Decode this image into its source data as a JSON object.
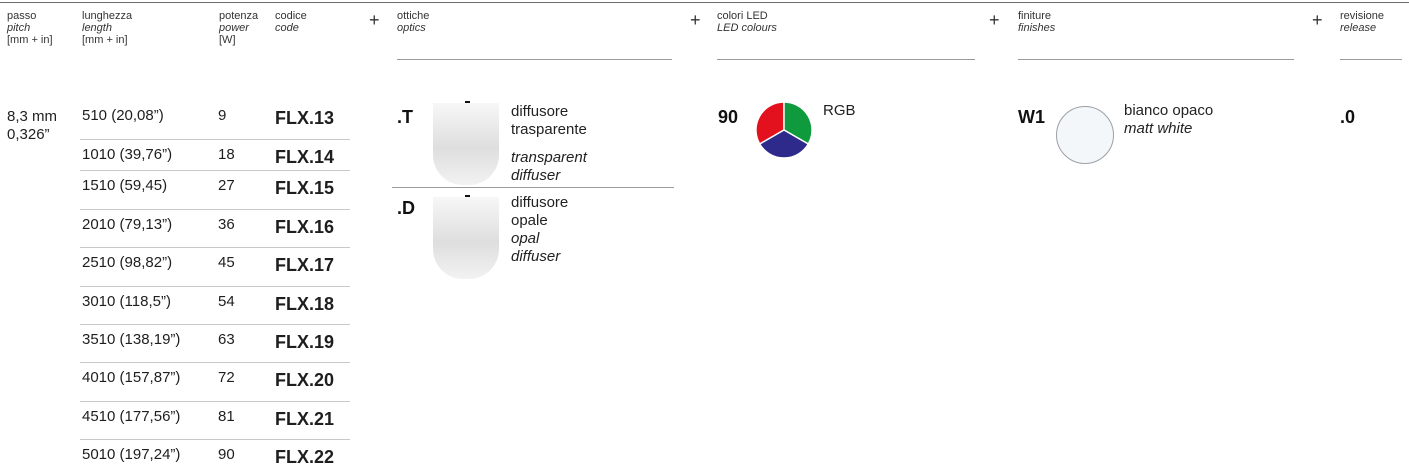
{
  "headers": {
    "pitch": {
      "it": "passo",
      "en": "pitch",
      "unit": "[mm + in]"
    },
    "length": {
      "it": "lunghezza",
      "en": "length",
      "unit": "[mm + in]"
    },
    "power": {
      "it": "potenza",
      "en": "power",
      "unit": "[W]"
    },
    "code": {
      "it": "codice",
      "en": "code"
    },
    "optics": {
      "it": "ottiche",
      "en": "optics"
    },
    "led": {
      "it": "colori LED",
      "en": "LED colours"
    },
    "finishes": {
      "it": "finiture",
      "en": "finishes"
    },
    "release": {
      "it": "revisione",
      "en": "release"
    },
    "plus": "+"
  },
  "pitch": {
    "mm": "8,3 mm",
    "in": "0,326”"
  },
  "rows": [
    {
      "length": "510 (20,08”)",
      "power": "9",
      "code": "FLX.13"
    },
    {
      "length": "1010 (39,76”)",
      "power": "18",
      "code": "FLX.14"
    },
    {
      "length": "1510 (59,45)",
      "power": "27",
      "code": "FLX.15"
    },
    {
      "length": "2010 (79,13”)",
      "power": "36",
      "code": "FLX.16"
    },
    {
      "length": "2510 (98,82”)",
      "power": "45",
      "code": "FLX.17"
    },
    {
      "length": "3010 (118,5”)",
      "power": "54",
      "code": "FLX.18"
    },
    {
      "length": "3510 (138,19”)",
      "power": "63",
      "code": "FLX.19"
    },
    {
      "length": "4010 (157,87”)",
      "power": "72",
      "code": "FLX.20"
    },
    {
      "length": "4510 (177,56”)",
      "power": "81",
      "code": "FLX.21"
    },
    {
      "length": "5010 (197,24”)",
      "power": "90",
      "code": "FLX.22"
    }
  ],
  "optics": [
    {
      "code": ".T",
      "it1": "diffusore",
      "it2": "trasparente",
      "en1": "transparent",
      "en2": "diffuser"
    },
    {
      "code": ".D",
      "it1": "diffusore",
      "it2": "opale",
      "en1": "opal",
      "en2": "diffuser"
    }
  ],
  "led": {
    "code": "90",
    "label": "RGB",
    "colors": [
      "#e3101e",
      "#109a3e",
      "#2e2a8c"
    ]
  },
  "finish": {
    "code": "W1",
    "it": "bianco opaco",
    "en": "matt white",
    "swatch": "#f3f7fa"
  },
  "release": {
    "code": ".0"
  }
}
